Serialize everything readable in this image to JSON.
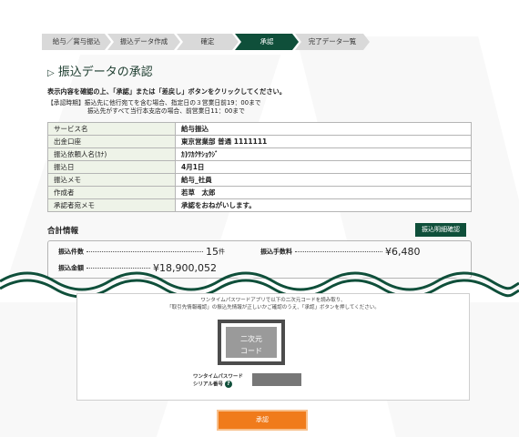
{
  "stepper": [
    {
      "label": "給与／賞与振込",
      "active": false
    },
    {
      "label": "振込データ作成",
      "active": false
    },
    {
      "label": "確定",
      "active": false
    },
    {
      "label": "承認",
      "active": true
    },
    {
      "label": "完了データ一覧",
      "active": false
    }
  ],
  "page": {
    "title": "振込データの承認",
    "instruction": "表示内容を確認の上、「承認」または「差戻し」ボタンをクリックしてください。",
    "note_line1": "【承認時期】振込先に他行宛てを含む場合、指定日の３営業日前19：00まで",
    "note_line2": "振込先がすべて当行本支店の場合、前営業日11：00まで"
  },
  "info_table": [
    {
      "key": "サービス名",
      "value": "給与振込"
    },
    {
      "key": "出金口座",
      "value": "東京営業部 普通 1111111"
    },
    {
      "key": "振込依頼人名(ｶﾅ)",
      "value": "ｶ)ﾜｶｸｻｼｮｳｼﾞ"
    },
    {
      "key": "振込日",
      "value": "4月1日"
    },
    {
      "key": "振込メモ",
      "value": "給与_社員"
    },
    {
      "key": "作成者",
      "value": "若草　太郎"
    },
    {
      "key": "承認者宛メモ",
      "value": "承認をおねがいします。"
    }
  ],
  "summary": {
    "title": "合計情報",
    "detail_button": "振込明細確認",
    "count_label": "振込件数",
    "count_value": "15",
    "count_unit": "件",
    "fee_label": "振込手数料",
    "fee_value": "¥6,480",
    "amount_label": "振込金額",
    "amount_value": "¥18,900,052"
  },
  "otp": {
    "text_line1": "ワンタイムパスワードアプリで以下の二次元コードを読み取り、",
    "text_line2": "「取引先情報確認」の振込先情報が正しいかご確認のうえ、「承認」ボタンを押してください。",
    "qr_line1": "二次元",
    "qr_line2": "コード",
    "serial_label_line1": "ワンタイムパスワード",
    "serial_label_line2": "シリアル番号",
    "help_glyph": "?"
  },
  "approve_button": "承認",
  "colors": {
    "brand_green": "#0f4f3a",
    "approve_orange": "#f07b1b"
  }
}
